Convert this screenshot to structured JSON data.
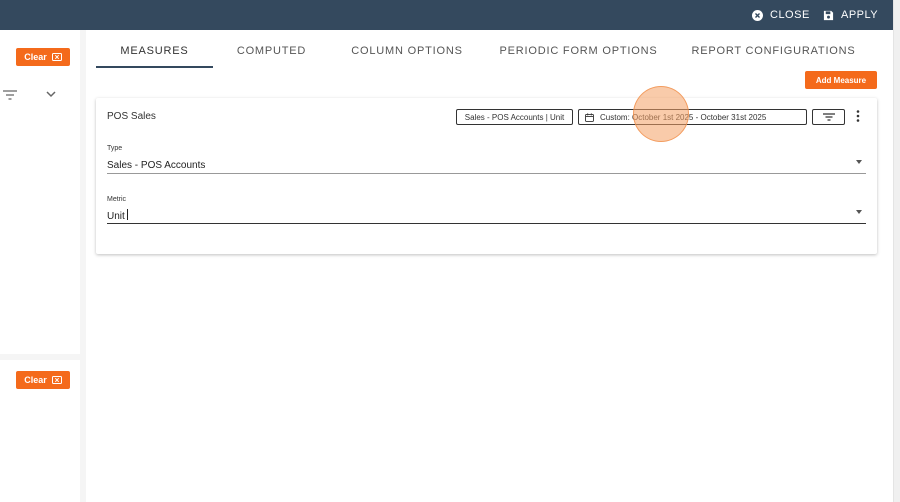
{
  "header": {
    "close_label": "CLOSE",
    "apply_label": "APPLY"
  },
  "left_panel": {
    "clear_label_top": "Clear",
    "clear_label_bottom": "Clear"
  },
  "tabs": [
    {
      "label": "MEASURES",
      "active": true
    },
    {
      "label": "COMPUTED",
      "active": false
    },
    {
      "label": "COLUMN OPTIONS",
      "active": false
    },
    {
      "label": "PERIODIC FORM OPTIONS",
      "active": false
    },
    {
      "label": "REPORT CONFIGURATIONS",
      "active": false
    }
  ],
  "add_measure_label": "Add Measure",
  "measure_card": {
    "title": "POS Sales",
    "account_chip": "Sales - POS Accounts | Unit",
    "date_chip": "Custom: October 1st 2025 - October 31st 2025",
    "type": {
      "label": "Type",
      "value": "Sales - POS Accounts"
    },
    "metric": {
      "label": "Metric",
      "value": "Unit"
    }
  },
  "colors": {
    "topbar": "#34495e",
    "accent": "#f46a1b",
    "click_indicator": "#f4a064"
  }
}
